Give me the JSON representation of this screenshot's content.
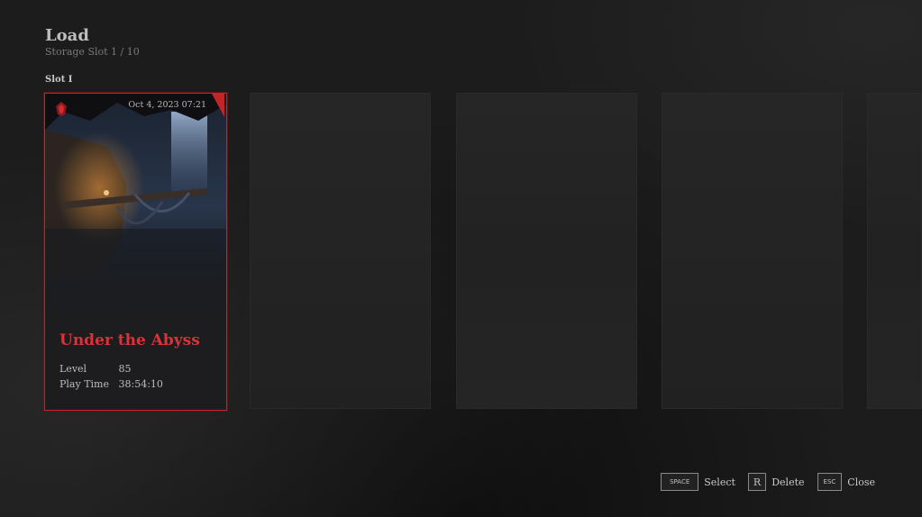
{
  "header": {
    "title": "Load",
    "subtitle": "Storage Slot 1 / 10",
    "slot_label": "Slot I"
  },
  "slots": [
    {
      "date": "Oct 4, 2023 07:21",
      "name": "Under the Abyss",
      "level_label": "Level",
      "level": "85",
      "playtime_label": "Play Time",
      "playtime": "38:54:10"
    }
  ],
  "footer": {
    "space_key": "SPACE",
    "select_label": "Select",
    "r_key": "R",
    "delete_label": "Delete",
    "esc_key": "ESC",
    "close_label": "Close"
  },
  "colors": {
    "accent": "#c0262a",
    "title_text": "#d8333a"
  }
}
